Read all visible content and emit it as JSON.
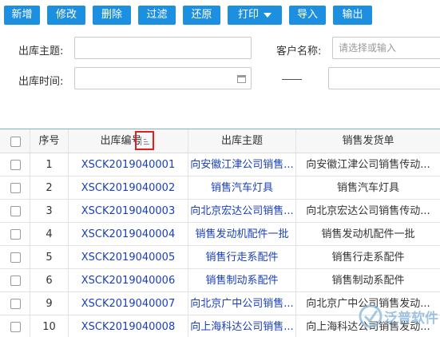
{
  "toolbar": {
    "buttons": [
      "新增",
      "修改",
      "删除",
      "过滤",
      "还原",
      "打印",
      "导入",
      "输出"
    ]
  },
  "form": {
    "subject_label": "出库主题:",
    "customer_label": "客户名称:",
    "customer_placeholder": "请选择或输入",
    "time_label": "出库时间:"
  },
  "grid": {
    "headers": {
      "index": "序号",
      "code": "出库编号",
      "subject": "出库主题",
      "delivery": "销售发货单"
    },
    "rows": [
      {
        "index": "1",
        "code": "XSCK2019040001",
        "subject": "向安徽江津公司销售...",
        "delivery": "向安徽江津公司销售传动..."
      },
      {
        "index": "2",
        "code": "XSCK2019040002",
        "subject": "销售汽车灯具",
        "delivery": "销售汽车灯具"
      },
      {
        "index": "3",
        "code": "XSCK2019040003",
        "subject": "向北京宏达公司销售...",
        "delivery": "向北京宏达公司销售传动..."
      },
      {
        "index": "4",
        "code": "XSCK2019040004",
        "subject": "销售发动机配件一批",
        "delivery": "销售发动机配件一批"
      },
      {
        "index": "5",
        "code": "XSCK2019040005",
        "subject": "销售行走系配件",
        "delivery": "销售行走系配件"
      },
      {
        "index": "6",
        "code": "XSCK2019040006",
        "subject": "销售制动系配件",
        "delivery": "销售制动系配件"
      },
      {
        "index": "9",
        "code": "XSCK2019040007",
        "subject": "向北京广中公司销售...",
        "delivery": "向北京广中公司销售发动..."
      },
      {
        "index": "10",
        "code": "XSCK2019040008",
        "subject": "向上海科达公司销售...",
        "delivery": "向上海科达公司销售发动..."
      }
    ]
  },
  "watermark": {
    "text": "泛普软件"
  }
}
